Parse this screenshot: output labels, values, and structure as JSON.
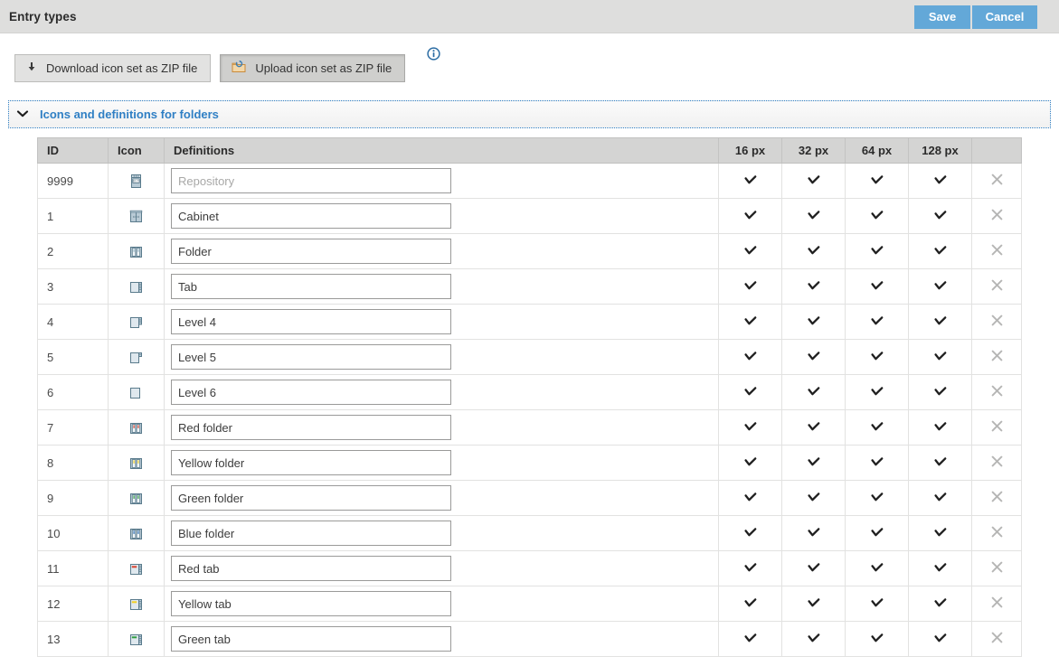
{
  "window": {
    "title": "Entry types"
  },
  "header_actions": {
    "save_label": "Save",
    "cancel_label": "Cancel"
  },
  "toolbar": {
    "download_label": "Download icon set as ZIP file",
    "upload_label": "Upload icon set as ZIP file",
    "download_icon": "download-arrow-icon",
    "upload_icon": "folder-upload-icon",
    "info_icon": "info-circle-icon"
  },
  "section": {
    "expand_icon": "chevron-down-icon",
    "label": "Icons and definitions for folders",
    "expanded": true
  },
  "table": {
    "columns": [
      "ID",
      "Icon",
      "Definitions",
      "16 px",
      "32 px",
      "64 px",
      "128 px",
      ""
    ],
    "check_glyph": "check-icon",
    "delete_glyph": "close-x-icon",
    "rows": [
      {
        "id": "9999",
        "icon": "repository-elo-icon",
        "definition": "",
        "placeholder": "Repository",
        "px16": true,
        "px32": true,
        "px64": true,
        "px128": true
      },
      {
        "id": "1",
        "icon": "cabinet-icon",
        "definition": "Cabinet",
        "placeholder": "",
        "px16": true,
        "px32": true,
        "px64": true,
        "px128": true
      },
      {
        "id": "2",
        "icon": "folder-binders-icon",
        "definition": "Folder",
        "placeholder": "",
        "px16": true,
        "px32": true,
        "px64": true,
        "px128": true
      },
      {
        "id": "3",
        "icon": "tab-icon",
        "definition": "Tab",
        "placeholder": "",
        "px16": true,
        "px32": true,
        "px64": true,
        "px128": true
      },
      {
        "id": "4",
        "icon": "level4-icon",
        "definition": "Level 4",
        "placeholder": "",
        "px16": true,
        "px32": true,
        "px64": true,
        "px128": true
      },
      {
        "id": "5",
        "icon": "level5-icon",
        "definition": "Level 5",
        "placeholder": "",
        "px16": true,
        "px32": true,
        "px64": true,
        "px128": true
      },
      {
        "id": "6",
        "icon": "level6-icon",
        "definition": "Level 6",
        "placeholder": "",
        "px16": true,
        "px32": true,
        "px64": true,
        "px128": true
      },
      {
        "id": "7",
        "icon": "red-folder-icon",
        "definition": "Red folder",
        "placeholder": "",
        "px16": true,
        "px32": true,
        "px64": true,
        "px128": true
      },
      {
        "id": "8",
        "icon": "yellow-folder-icon",
        "definition": "Yellow folder",
        "placeholder": "",
        "px16": true,
        "px32": true,
        "px64": true,
        "px128": true
      },
      {
        "id": "9",
        "icon": "green-folder-icon",
        "definition": "Green folder",
        "placeholder": "",
        "px16": true,
        "px32": true,
        "px64": true,
        "px128": true
      },
      {
        "id": "10",
        "icon": "blue-folder-icon",
        "definition": "Blue folder",
        "placeholder": "",
        "px16": true,
        "px32": true,
        "px64": true,
        "px128": true
      },
      {
        "id": "11",
        "icon": "red-tab-icon",
        "definition": "Red tab",
        "placeholder": "",
        "px16": true,
        "px32": true,
        "px64": true,
        "px128": true
      },
      {
        "id": "12",
        "icon": "yellow-tab-icon",
        "definition": "Yellow tab",
        "placeholder": "",
        "px16": true,
        "px32": true,
        "px64": true,
        "px128": true
      },
      {
        "id": "13",
        "icon": "green-tab-icon",
        "definition": "Green tab",
        "placeholder": "",
        "px16": true,
        "px32": true,
        "px64": true,
        "px128": true
      }
    ]
  },
  "colors": {
    "accent_blue": "#2f7fc4",
    "button_blue": "#63a8d8",
    "titlebar_grey": "#dededd",
    "header_grey": "#d4d4d3",
    "icon_blue_grey": "#7f9aad",
    "red": "#d9432f",
    "yellow": "#f2d022",
    "green": "#2f9e3f"
  }
}
